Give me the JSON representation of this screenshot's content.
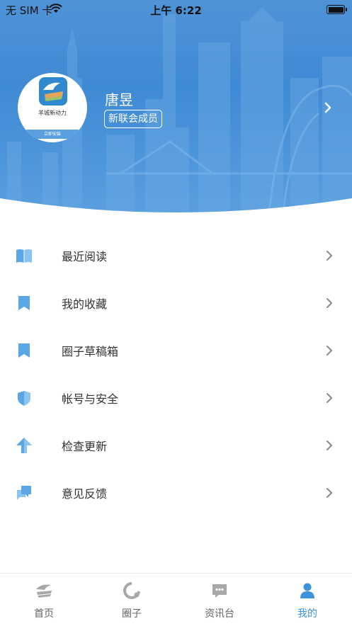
{
  "status_bar": {
    "carrier": "无 SIM 卡",
    "time": "上午 6:22"
  },
  "profile": {
    "avatar_app_name": "羊城新动力",
    "avatar_install_label": "立即安装",
    "name": "唐昱",
    "badge": "新联会成员"
  },
  "menu": [
    {
      "label": "最近阅读",
      "icon": "book-icon"
    },
    {
      "label": "我的收藏",
      "icon": "bookmark-icon"
    },
    {
      "label": "圈子草稿箱",
      "icon": "drafts-bookmark-icon"
    },
    {
      "label": "帐号与安全",
      "icon": "shield-icon"
    },
    {
      "label": "检查更新",
      "icon": "arrow-up-icon"
    },
    {
      "label": "意见反馈",
      "icon": "chat-bubbles-icon"
    }
  ],
  "tabs": [
    {
      "label": "首页",
      "icon": "home-logo-icon",
      "active": false
    },
    {
      "label": "圈子",
      "icon": "circle-icon",
      "active": false
    },
    {
      "label": "资讯台",
      "icon": "news-chat-icon",
      "active": false
    },
    {
      "label": "我的",
      "icon": "person-icon",
      "active": true
    }
  ],
  "colors": {
    "accent": "#3d93dc",
    "header_blue": "#4f93d6",
    "icon_blue": "#5aa6e6",
    "inactive_gray": "#9a9a9a"
  }
}
